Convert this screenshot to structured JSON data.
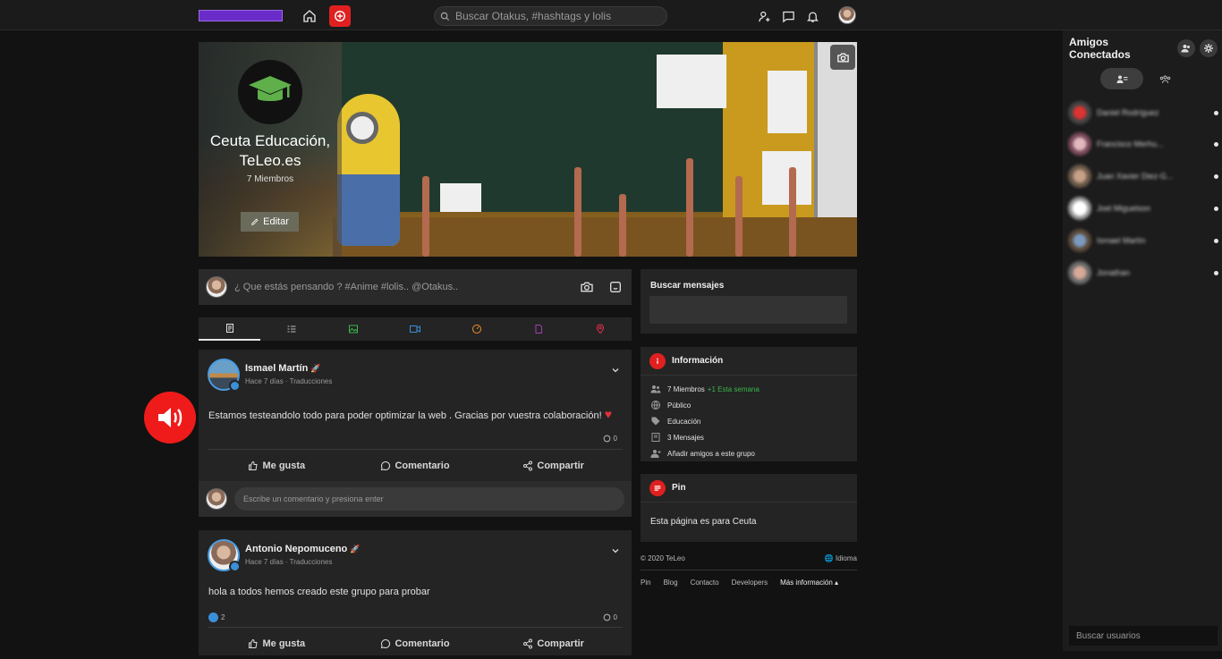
{
  "topbar": {
    "search_placeholder": "Buscar Otakus, #hashtags y lolis"
  },
  "group": {
    "name": "Ceuta Educación, TeLeo.es",
    "members": "7 Miembros",
    "edit_label": "Editar"
  },
  "composer": {
    "placeholder": "¿ Que estás pensando ? #Anime #lolis.. @Otakus.."
  },
  "tabs": [
    {
      "icon": "document-icon",
      "color": "#e6e6e6"
    },
    {
      "icon": "list-icon",
      "color": "#bbbbbb"
    },
    {
      "icon": "image-icon",
      "color": "#39b54a"
    },
    {
      "icon": "video-icon",
      "color": "#3b8fd8"
    },
    {
      "icon": "gauge-icon",
      "color": "#f0902a"
    },
    {
      "icon": "file-icon",
      "color": "#a03fb0"
    },
    {
      "icon": "location-icon",
      "color": "#e0304a"
    }
  ],
  "posts": [
    {
      "author": "Ismael Martín",
      "meta": "Hace 7 días · Traducciones",
      "text": "Estamos testeandolo todo para poder optimizar la web . Gracias por vuestra colaboración!",
      "likes": "",
      "comments": "0",
      "like_label": "Me gusta",
      "comment_label": "Comentario",
      "share_label": "Compartir",
      "comment_placeholder": "Escribe un comentario y presiona enter"
    },
    {
      "author": "Antonio Nepomuceno",
      "meta": "Hace 7 días · Traducciones",
      "text": "hola a todos hemos creado este grupo para probar",
      "likes": "2",
      "comments": "0",
      "like_label": "Me gusta",
      "comment_label": "Comentario",
      "share_label": "Compartir"
    }
  ],
  "sidebar": {
    "search_title": "Buscar mensajes",
    "info_title": "Información",
    "info_items": {
      "members": "7 Miembros",
      "members_new": "+1 Esta semana",
      "privacy": "Público",
      "category": "Educación",
      "messages": "3 Mensajes",
      "add_friends": "Añadir amigos a este grupo"
    },
    "pin_title": "Pin",
    "pin_text": "Esta página es para Ceuta"
  },
  "footer": {
    "copyright": "© 2020 TeLeo",
    "language": "Idioma",
    "links": [
      "Pin",
      "Blog",
      "Contacto",
      "Developers"
    ],
    "more": "Más información ▴"
  },
  "friends_panel": {
    "title": "Amigos Conectados",
    "friends": [
      {
        "name": "Daniel Rodríguez"
      },
      {
        "name": "Francisco Merhu..."
      },
      {
        "name": "Juan Xavier Diez-G..."
      },
      {
        "name": "Joel Miguelson"
      },
      {
        "name": "Ismael Martín"
      },
      {
        "name": "Jonathan"
      }
    ],
    "search_placeholder": "Buscar usuarios"
  }
}
